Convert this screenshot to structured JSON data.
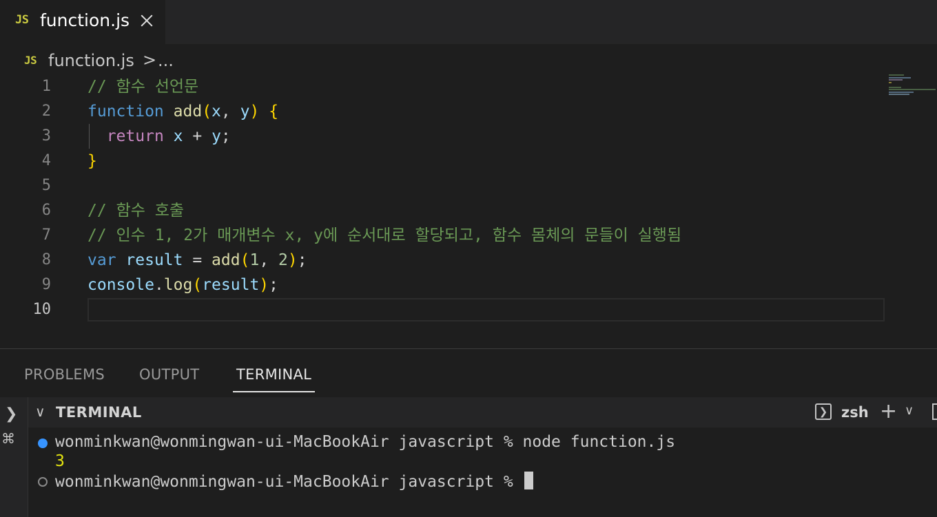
{
  "tab": {
    "icon_label": "JS",
    "title": "function.js"
  },
  "breadcrumb": {
    "icon_label": "JS",
    "file": "function.js",
    "separator": ">",
    "more": "..."
  },
  "editor": {
    "line_numbers": [
      "1",
      "2",
      "3",
      "4",
      "5",
      "6",
      "7",
      "8",
      "9",
      "10"
    ],
    "active_line": "10",
    "lines": [
      {
        "tokens": [
          "// 함수 선언문"
        ]
      },
      {
        "tokens": [
          "function",
          " ",
          "add",
          "(",
          "x",
          ", ",
          "y",
          ")",
          " ",
          "{"
        ]
      },
      {
        "tokens": [
          "  ",
          "return",
          " ",
          "x",
          " + ",
          "y",
          ";"
        ]
      },
      {
        "tokens": [
          "}"
        ]
      },
      {
        "tokens": []
      },
      {
        "tokens": [
          "// 함수 호출"
        ]
      },
      {
        "tokens": [
          "// 인수 1, 2가 매개변수 x, y에 순서대로 할당되고, 함수 몸체의 문들이 실행됨"
        ]
      },
      {
        "tokens": [
          "var",
          " ",
          "result",
          " = ",
          "add",
          "(",
          "1",
          ", ",
          "2",
          ")",
          ";"
        ]
      },
      {
        "tokens": [
          "console",
          ".",
          "log",
          "(",
          "result",
          ")",
          ";"
        ]
      },
      {
        "tokens": []
      }
    ]
  },
  "panel": {
    "tabs": [
      "PROBLEMS",
      "OUTPUT",
      "TERMINAL"
    ],
    "active_tab": "TERMINAL",
    "terminal_header": "TERMINAL",
    "shell_name": "zsh",
    "lines": [
      {
        "prompt": "wonminkwan@wonmingwan-ui-MacBookAir javascript % node function.js"
      },
      {
        "output": "3"
      },
      {
        "prompt": "wonminkwan@wonmingwan-ui-MacBookAir javascript % "
      }
    ]
  },
  "colors": {
    "editor_bg": "#1e1e1e",
    "comment": "#6a9955",
    "keyword": "#569cd6",
    "control": "#c586c0",
    "function": "#dcdcaa",
    "variable": "#9cdcfe",
    "number": "#b5cea8",
    "bracket": "#ffd700",
    "terminal_output": "#e5e510",
    "status_dot": "#3794ff"
  }
}
